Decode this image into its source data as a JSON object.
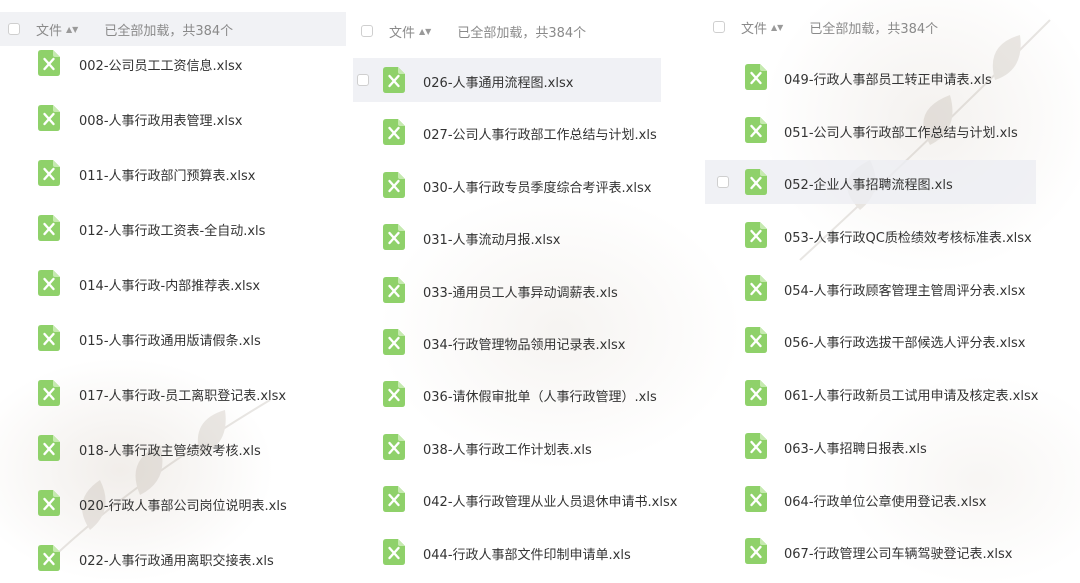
{
  "header": {
    "column_label": "文件",
    "sort_glyph": "▲▼",
    "count_text": "已全部加载，共384个"
  },
  "icons": {
    "file_icon": "excel-file-icon",
    "file_icon_color": "#8fd16a",
    "sort_icon": "sort-icon",
    "checkbox": "checkbox-icon"
  },
  "columns": [
    {
      "files": [
        "002-公司员工工资信息.xlsx",
        "008-人事行政用表管理.xlsx",
        "011-人事行政部门预算表.xlsx",
        "012-人事行政工资表-全自动.xls",
        "014-人事行政-内部推荐表.xlsx",
        "015-人事行政通用版请假条.xls",
        "017-人事行政-员工离职登记表.xlsx",
        "018-人事行政主管绩效考核.xls",
        "020-行政人事部公司岗位说明表.xls",
        "022-人事行政通用离职交接表.xls"
      ]
    },
    {
      "files": [
        "026-人事通用流程图.xlsx",
        "027-公司人事行政部工作总结与计划.xls",
        "030-人事行政专员季度综合考评表.xlsx",
        "031-人事流动月报.xlsx",
        "033-通用员工人事异动调薪表.xls",
        "034-行政管理物品领用记录表.xlsx",
        "036-请休假审批单（人事行政管理）.xls",
        "038-人事行政工作计划表.xls",
        "042-人事行政管理从业人员退休申请书.xlsx",
        "044-行政人事部文件印制申请单.xls"
      ]
    },
    {
      "files": [
        "049-行政人事部员工转正申请表.xls",
        "051-公司人事行政部工作总结与计划.xls",
        "052-企业人事招聘流程图.xls",
        "053-人事行政QC质检绩效考核标准表.xlsx",
        "054-人事行政顾客管理主管周评分表.xlsx",
        "056-人事行政选拔干部候选人评分表.xlsx",
        "061-人事行政新员工试用申请及核定表.xlsx",
        "063-人事招聘日报表.xls",
        "064-行政单位公章使用登记表.xlsx",
        "067-行政管理公司车辆驾驶登记表.xlsx"
      ]
    }
  ]
}
